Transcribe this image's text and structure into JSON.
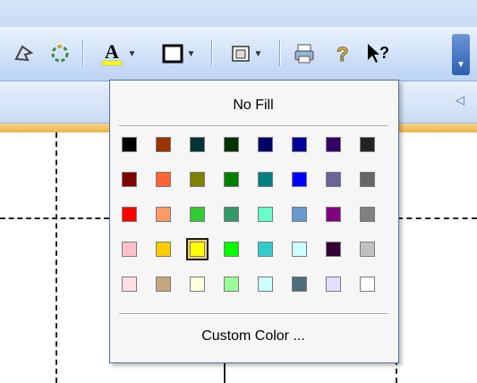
{
  "toolbar": {
    "buttons": [
      {
        "name": "shape-select-icon",
        "glyph": "ᗩ"
      },
      {
        "name": "rotate-shape-icon",
        "glyph": "⟲"
      },
      {
        "name": "font-color-icon",
        "glyph": "A"
      },
      {
        "name": "line-color-icon",
        "glyph": "□"
      },
      {
        "name": "paste-icon",
        "glyph": "▣"
      },
      {
        "name": "print-icon",
        "glyph": "⎙"
      },
      {
        "name": "help-icon",
        "glyph": "?"
      },
      {
        "name": "whats-this-icon",
        "glyph": "↖?"
      }
    ]
  },
  "dropdown": {
    "no_fill_label": "No Fill",
    "custom_label": "Custom Color ...",
    "colors": [
      [
        "#000000",
        "#993300",
        "#003333",
        "#003300",
        "#000066",
        "#000099",
        "#330066",
        "#222222"
      ],
      [
        "#800000",
        "#ff6633",
        "#808000",
        "#008000",
        "#008080",
        "#0000ff",
        "#666699",
        "#666666"
      ],
      [
        "#ff0000",
        "#ff9966",
        "#33cc33",
        "#339966",
        "#66ffcc",
        "#6699cc",
        "#800080",
        "#808080"
      ],
      [
        "#ffc0cb",
        "#ffcc00",
        "#ffff00",
        "#00ff00",
        "#33cccc",
        "#ccffff",
        "#330033",
        "#c0c0c0"
      ],
      [
        "#ffe0e0",
        "#c4a77d",
        "#ffffe0",
        "#99ff99",
        "#ccffff",
        "#4f6f7a",
        "#e0e0ff",
        "#ffffff"
      ]
    ],
    "selected": [
      3,
      2
    ]
  },
  "colors": {
    "underline_accent": "#ffff00"
  }
}
